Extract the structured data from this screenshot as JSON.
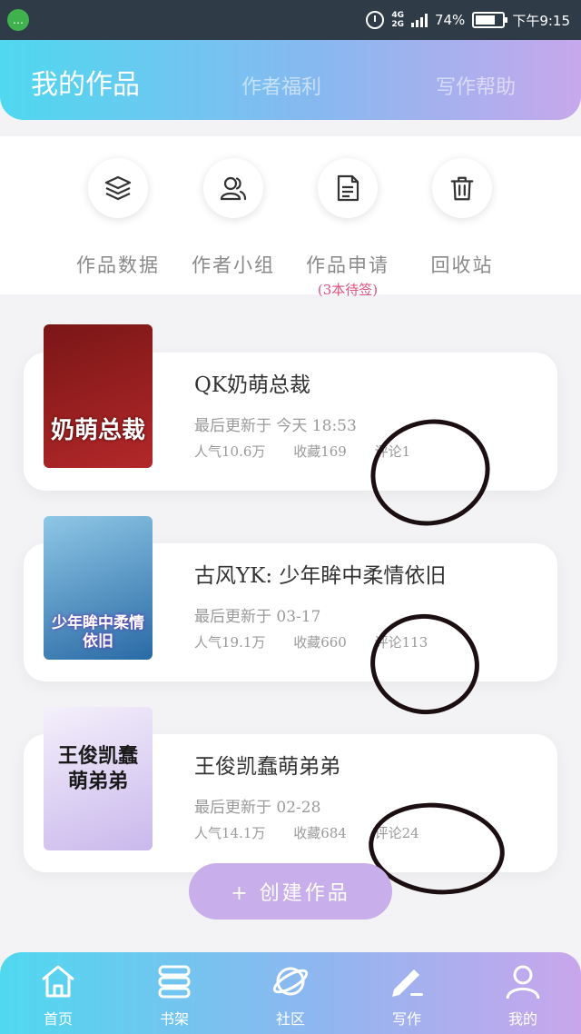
{
  "status_bar": {
    "network": "4G\n2G",
    "network_top": "4G",
    "network_bottom": "2G",
    "battery": "74%",
    "battery_level": 0.74,
    "time": "下午9:15"
  },
  "header": {
    "tabs": [
      {
        "label": "我的作品",
        "active": true
      },
      {
        "label": "作者福利",
        "active": false
      },
      {
        "label": "写作帮助",
        "active": false
      }
    ]
  },
  "actions": [
    {
      "label": "作品数据",
      "icon": "layers-icon"
    },
    {
      "label": "作者小组",
      "icon": "group-icon"
    },
    {
      "label": "作品申请",
      "sublabel": "(3本待签)",
      "icon": "document-icon"
    },
    {
      "label": "回收站",
      "icon": "trash-icon"
    }
  ],
  "works": [
    {
      "title": "QK奶萌总裁",
      "updated": "最后更新于 今天 18:53",
      "popularity": "人气10.6万",
      "favorites": "收藏169",
      "comments": "评论1",
      "cover_text": "奶萌总裁",
      "cover_colors": [
        "#7a1616",
        "#b3282a"
      ]
    },
    {
      "title": "古风YK: 少年眸中柔情依旧",
      "updated": "最后更新于 03-17",
      "popularity": "人气19.1万",
      "favorites": "收藏660",
      "comments": "评论113",
      "cover_text": "少年眸中柔情依旧",
      "cover_colors": [
        "#8ec7e6",
        "#2a6aa5"
      ]
    },
    {
      "title": "王俊凯蠢萌弟弟",
      "updated": "最后更新于 02-28",
      "popularity": "人气14.1万",
      "favorites": "收藏684",
      "comments": "评论24",
      "cover_text": "王俊凯蠢萌弟弟",
      "cover_colors": [
        "#f4f0fb",
        "#c9b8ec"
      ]
    }
  ],
  "create_button": "+ 创建作品",
  "bottom_nav": [
    {
      "label": "首页",
      "icon": "home-icon"
    },
    {
      "label": "书架",
      "icon": "bookshelf-icon"
    },
    {
      "label": "社区",
      "icon": "planet-icon"
    },
    {
      "label": "写作",
      "icon": "pen-icon",
      "active": true
    },
    {
      "label": "我的",
      "icon": "profile-icon"
    }
  ]
}
